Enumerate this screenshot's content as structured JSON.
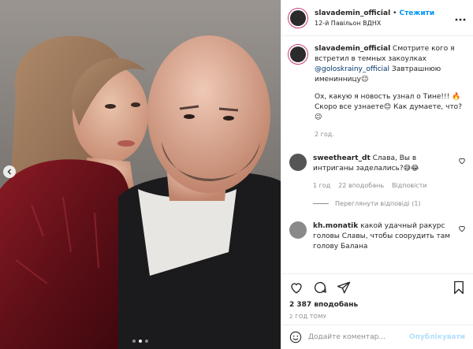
{
  "header": {
    "username": "slavademin_official",
    "separator": "•",
    "follow_label": "Стежити",
    "location": "12-й Павільон ВДНХ"
  },
  "caption": {
    "username": "slavademin_official",
    "text_1": "Смотрите кого я встретил в темных закоулках",
    "mention": "@goloskrainy_official",
    "text_2": "Завтрашнюю именинницу😉",
    "para_2": "Ох, какую я новость узнал о Тине!!! 🔥 Скоро все узнаете😊 Как думаете, что?😉",
    "time": "2 год."
  },
  "comments": [
    {
      "username": "sweetheart_dt",
      "text": "Слава, Вы в интриганы заделались?😅😂",
      "time": "1 год",
      "likes": "22 вподобань",
      "reply": "Відповісти",
      "view_replies": "Переглянути відповіді (1)"
    },
    {
      "username": "kh.monatik",
      "text": "какой удачный ракурс головы Славы, чтобы соорудить там голову Балана"
    }
  ],
  "actions": {
    "likes": "2 387 вподобань",
    "time_ago": "2 ГОД ТОМУ"
  },
  "comment_box": {
    "placeholder": "Додайте коментар...",
    "emoji_icon": "smiley-icon",
    "publish_label": "Опублікувати"
  },
  "carousel": {
    "dots": 3,
    "active_index": 1
  }
}
